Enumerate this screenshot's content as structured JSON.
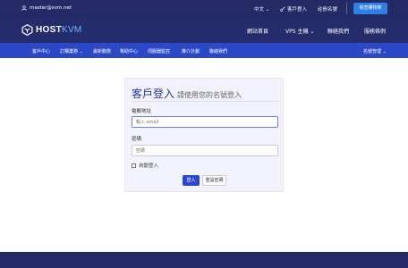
{
  "topbar": {
    "email": "master@svm.net",
    "language": "中文",
    "login": "客戶登入",
    "register": "註冊名號",
    "cart_button": "檢查購物車"
  },
  "brand": {
    "name_main": "HOST",
    "name_accent": "KVM"
  },
  "main_nav": [
    {
      "label": "網站首頁"
    },
    {
      "label": "VPS 主機"
    },
    {
      "label": "聯絡我們"
    },
    {
      "label": "服務條例"
    }
  ],
  "sub_nav": {
    "items": [
      {
        "label": "客戶中心"
      },
      {
        "label": "訂購業務"
      },
      {
        "label": "最新動態"
      },
      {
        "label": "幫助中心"
      },
      {
        "label": "伺服器監控"
      },
      {
        "label": "推介計劃"
      },
      {
        "label": "聯絡我們"
      }
    ],
    "account": "名號管理"
  },
  "login_form": {
    "title": "客戶登入",
    "subtitle": "請使用您的名號登入",
    "email_label": "電郵地址",
    "email_placeholder": "輸入 email",
    "password_label": "密碼",
    "password_placeholder": "密碼",
    "remember_label": "自動登入",
    "login_button": "登入",
    "reset_button": "重設密碼"
  },
  "colors": {
    "header_bg": "#232a66",
    "subnav_bg": "#2b48c9",
    "accent": "#2f7fe6"
  }
}
